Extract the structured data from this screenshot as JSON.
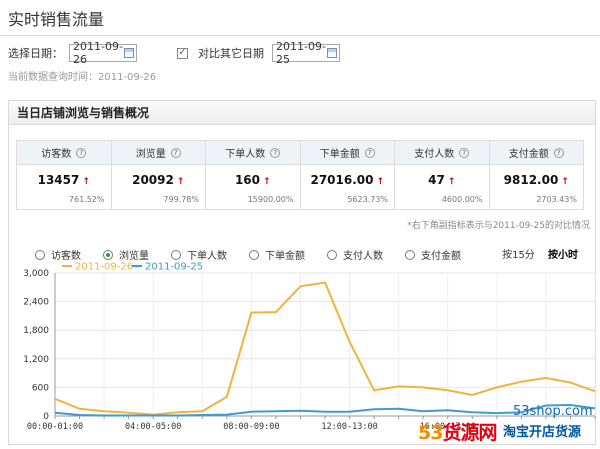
{
  "page": {
    "title": "实时销售流量"
  },
  "filters": {
    "date_label": "选择日期：",
    "date_value": "2011-09-26",
    "compare_checked": true,
    "compare_label": "对比其它日期",
    "compare_value": "2011-09-25",
    "query_time": "当前数据查询时间：2011-09-26"
  },
  "panel": {
    "title": "当日店铺浏览与销售概况"
  },
  "metrics": [
    {
      "label": "访客数",
      "value": "13457",
      "pct": "761.52%"
    },
    {
      "label": "浏览量",
      "value": "20092",
      "pct": "799.78%"
    },
    {
      "label": "下单人数",
      "value": "160",
      "pct": "15900.00%"
    },
    {
      "label": "下单金额",
      "value": "27016.00",
      "pct": "5623.73%"
    },
    {
      "label": "支付人数",
      "value": "47",
      "pct": "4600.00%"
    },
    {
      "label": "支付金额",
      "value": "9812.00",
      "pct": "2703.43%"
    }
  ],
  "footnote": "*右下角副指标表示与2011-09-25的对比情况",
  "radios": [
    {
      "label": "访客数",
      "selected": false
    },
    {
      "label": "浏览量",
      "selected": true
    },
    {
      "label": "下单人数",
      "selected": false
    },
    {
      "label": "下单金额",
      "selected": false
    },
    {
      "label": "支付人数",
      "selected": false
    },
    {
      "label": "支付金额",
      "selected": false
    }
  ],
  "granularity": {
    "by15": "按15分",
    "byhour": "按小时",
    "active": "byhour"
  },
  "colors": {
    "current": "#f0b43c",
    "compare": "#3e9bd3",
    "up_arrow": "#d10000",
    "panel_header": "#eeeeee"
  },
  "watermark": {
    "url": "53shop.com",
    "brand_left": "53",
    "brand_mid": "货源网",
    "sub": "淘宝开店货源"
  },
  "chart_data": {
    "type": "line",
    "x": [
      "00:00-01:00",
      "01:00-02:00",
      "02:00-03:00",
      "03:00-04:00",
      "04:00-05:00",
      "05:00-06:00",
      "06:00-07:00",
      "07:00-08:00",
      "08:00-09:00",
      "09:00-10:00",
      "10:00-11:00",
      "11:00-12:00",
      "12:00-13:00",
      "13:00-14:00",
      "14:00-15:00",
      "15:00-16:00",
      "16:00-17:00",
      "17:00-18:00",
      "18:00-19:00",
      "19:00-20:00",
      "20:00-21:00",
      "21:00-22:00",
      "22:00-23:00"
    ],
    "tick_labels": [
      "00:00-01:00",
      "04:00-05:00",
      "08:00-09:00",
      "12:00-13:00",
      "16:00-17:00"
    ],
    "series": [
      {
        "name": "2011-09-26",
        "values": [
          360,
          150,
          100,
          70,
          30,
          80,
          100,
          400,
          2170,
          2180,
          2720,
          2800,
          1560,
          540,
          620,
          600,
          540,
          440,
          600,
          720,
          800,
          700,
          520
        ]
      },
      {
        "name": "2011-09-25",
        "values": [
          70,
          20,
          10,
          10,
          10,
          10,
          20,
          30,
          90,
          100,
          110,
          90,
          90,
          140,
          150,
          100,
          120,
          80,
          60,
          80,
          220,
          230,
          160
        ]
      }
    ],
    "ylim": [
      0,
      3000
    ],
    "yticks": [
      "3,000",
      "2,400",
      "1,800",
      "1,200",
      "600",
      "0"
    ],
    "ytick_values": [
      3000,
      2400,
      1800,
      1200,
      600,
      0
    ]
  }
}
